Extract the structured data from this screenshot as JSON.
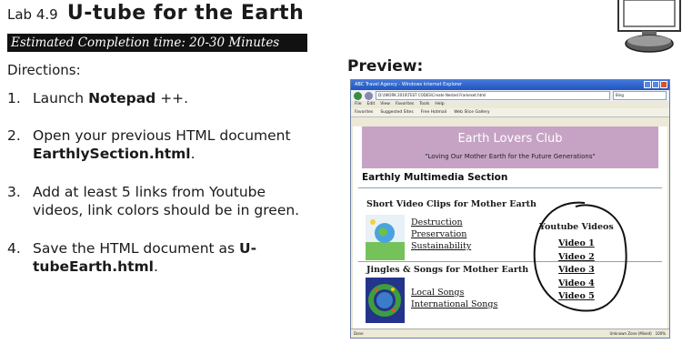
{
  "header": {
    "lab_number": "Lab 4.9",
    "lab_title": "U-tube for the Earth",
    "estimated_time": "Estimated Completion time:  20-30 Minutes"
  },
  "directions": {
    "heading": "Directions:",
    "steps": [
      {
        "num": "1.",
        "parts": [
          "Launch ",
          "Notepad",
          " ++."
        ]
      },
      {
        "num": "2.",
        "parts": [
          "Open your previous HTML document ",
          "EarthlySection.html",
          "."
        ]
      },
      {
        "num": "3.",
        "parts": [
          "Add at least 5 links from Youtube videos, link colors should be in green.",
          "",
          ""
        ]
      },
      {
        "num": "4.",
        "parts": [
          "Save the HTML document as ",
          "U-tubeEarth.html",
          "."
        ]
      }
    ]
  },
  "preview": {
    "heading": "Preview:",
    "browser": {
      "title": "ABC Travel Agency - Windows Internet Explorer",
      "address": "D:\\(WORK 2010\\TEST CODES\\Create Nested Frameset.html",
      "search_placeholder": "Bing",
      "menu": [
        "File",
        "Edit",
        "View",
        "Favorites",
        "Tools",
        "Help"
      ],
      "favorites": [
        "Favorites",
        "Suggested Sites",
        "Free Hotmail",
        "Web Slice Gallery"
      ],
      "status_left": "Done",
      "status_zone": "Unknown Zone (Mixed)",
      "zoom": "100%"
    },
    "page": {
      "banner_title": "Earth Lovers Club",
      "banner_tagline": "\"Loving Our Mother Earth for the Future Generations\"",
      "section_title": "Earthly Multimedia Section",
      "short_video_heading": "Short Video Clips for Mother Earth",
      "short_video_links": [
        "Destruction",
        "Preservation",
        "Sustainability"
      ],
      "jingles_heading": "Jingles & Songs for Mother Earth",
      "jingle_links": [
        "Local Songs",
        "International Songs"
      ],
      "youtube_heading": "Youtube Videos",
      "youtube_links": [
        "Video 1",
        "Video 2",
        "Video 3",
        "Video 4",
        "Video 5"
      ]
    }
  }
}
